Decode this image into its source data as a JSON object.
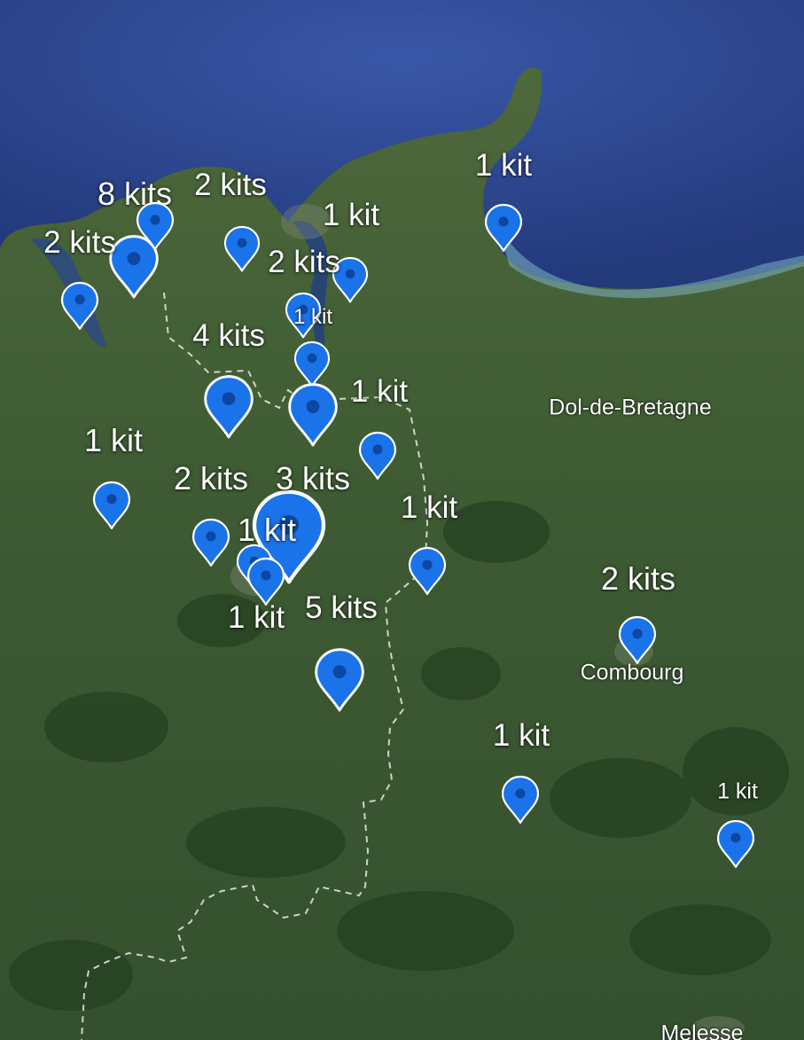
{
  "colors": {
    "sea": "#2a4690",
    "shallows": "#7fb3c4",
    "land": "#3b5a32",
    "forest": "#243f20",
    "marker": "#1a73e8",
    "marker_dot": "#0d47a1",
    "boundary": "#e8e8e8"
  },
  "places": [
    {
      "id": "dol",
      "name": "Dol-de-Bretagne"
    },
    {
      "id": "combourg",
      "name": "Combourg"
    },
    {
      "id": "melesse",
      "name": "Melesse"
    }
  ],
  "clusters": [
    {
      "id": "c01",
      "label": "8 kits",
      "kits": 8
    },
    {
      "id": "c02",
      "label": "2 kits",
      "kits": 2
    },
    {
      "id": "c03",
      "label": "2 kits",
      "kits": 2
    },
    {
      "id": "c04",
      "label": "1 kit",
      "kits": 1
    },
    {
      "id": "c05",
      "label": "2 kits",
      "kits": 2
    },
    {
      "id": "c06",
      "label": "1 kit",
      "kits": 1
    },
    {
      "id": "c07",
      "label": "1 kit",
      "kits": 1
    },
    {
      "id": "c08",
      "label": "4 kits",
      "kits": 4
    },
    {
      "id": "c09",
      "label": "1 kit",
      "kits": 1
    },
    {
      "id": "c10",
      "label": "1 kit",
      "kits": 1
    },
    {
      "id": "c11",
      "label": "2 kits",
      "kits": 2
    },
    {
      "id": "c12",
      "label": "3 kits",
      "kits": 3
    },
    {
      "id": "c13",
      "label": "1 kit",
      "kits": 1
    },
    {
      "id": "c14",
      "label": "1 kit",
      "kits": 1
    },
    {
      "id": "c15",
      "label": "5 kits",
      "kits": 5
    },
    {
      "id": "c16",
      "label": "1 kit",
      "kits": 1
    },
    {
      "id": "c17",
      "label": "2 kits",
      "kits": 2
    },
    {
      "id": "c18",
      "label": "1 kit",
      "kits": 1
    },
    {
      "id": "c19",
      "label": "1 kit",
      "kits": 1
    }
  ]
}
